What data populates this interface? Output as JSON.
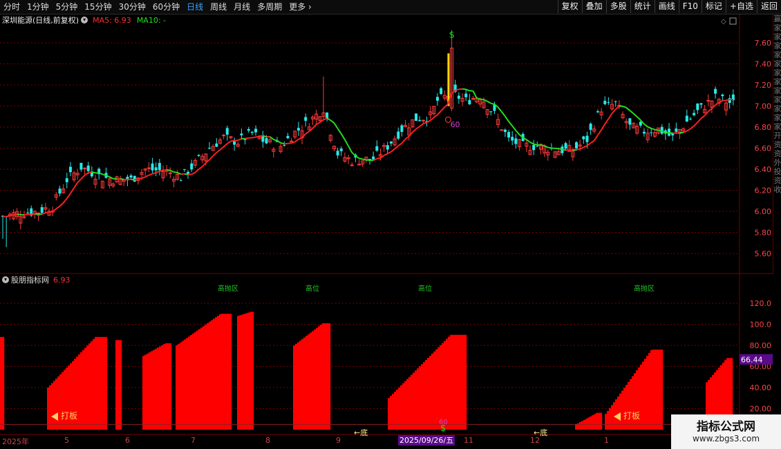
{
  "toolbar": {
    "periods": [
      "分时",
      "1分钟",
      "5分钟",
      "15分钟",
      "30分钟",
      "60分钟",
      "日线",
      "周线",
      "月线",
      "多周期",
      "更多"
    ],
    "active": "日线",
    "buttons": [
      "复权",
      "叠加",
      "多股",
      "统计",
      "画线",
      "F10",
      "标记",
      "+自选",
      "返回"
    ]
  },
  "main_chart": {
    "stock_title": "深圳能源(日线,前复权)",
    "ma5_label": "MA5: 6.93",
    "ma10_label": "MA10: -",
    "price_ticks": [
      "7.60",
      "7.40",
      "7.20",
      "7.00",
      "6.80",
      "6.60",
      "6.40",
      "6.20",
      "6.00",
      "5.80",
      "5.60"
    ],
    "annot_60": "60",
    "annot_dollar": "$"
  },
  "right_strip": [
    "赢",
    "家",
    "家",
    "家",
    "家",
    "家",
    "家",
    "家",
    "家",
    "家",
    "家",
    "家",
    "家",
    "开",
    "资",
    "资",
    "外",
    "投",
    "资",
    "收"
  ],
  "indicator": {
    "title": "股朋指标网",
    "value": "6.93",
    "ticks": [
      "120.0",
      "100.0",
      "80.00",
      "60.00",
      "40.00",
      "20.00"
    ],
    "badge": "66.44",
    "top_labels": [
      "高抛区",
      "高位",
      "高位",
      "高抛区"
    ],
    "daban_label": "打板",
    "di_label": "←底",
    "dollar": "$",
    "sixty": "60"
  },
  "xaxis": {
    "labels": [
      "2025年",
      "5",
      "6",
      "7",
      "8",
      "9",
      "11",
      "12",
      "1"
    ],
    "date_badge": "2025/09/26/五"
  },
  "watermark": {
    "title": "指标公式网",
    "url": "www.zbgs3.com"
  },
  "colors": {
    "up": "#ff3b3b",
    "down": "#28e8e8",
    "ma_red": "#ff2020",
    "ma_green": "#22dd22",
    "grid": "#7a0000",
    "tick_text": "#ff4444",
    "bar_red": "#ff0000",
    "active_tab": "#3aa0ff"
  }
}
